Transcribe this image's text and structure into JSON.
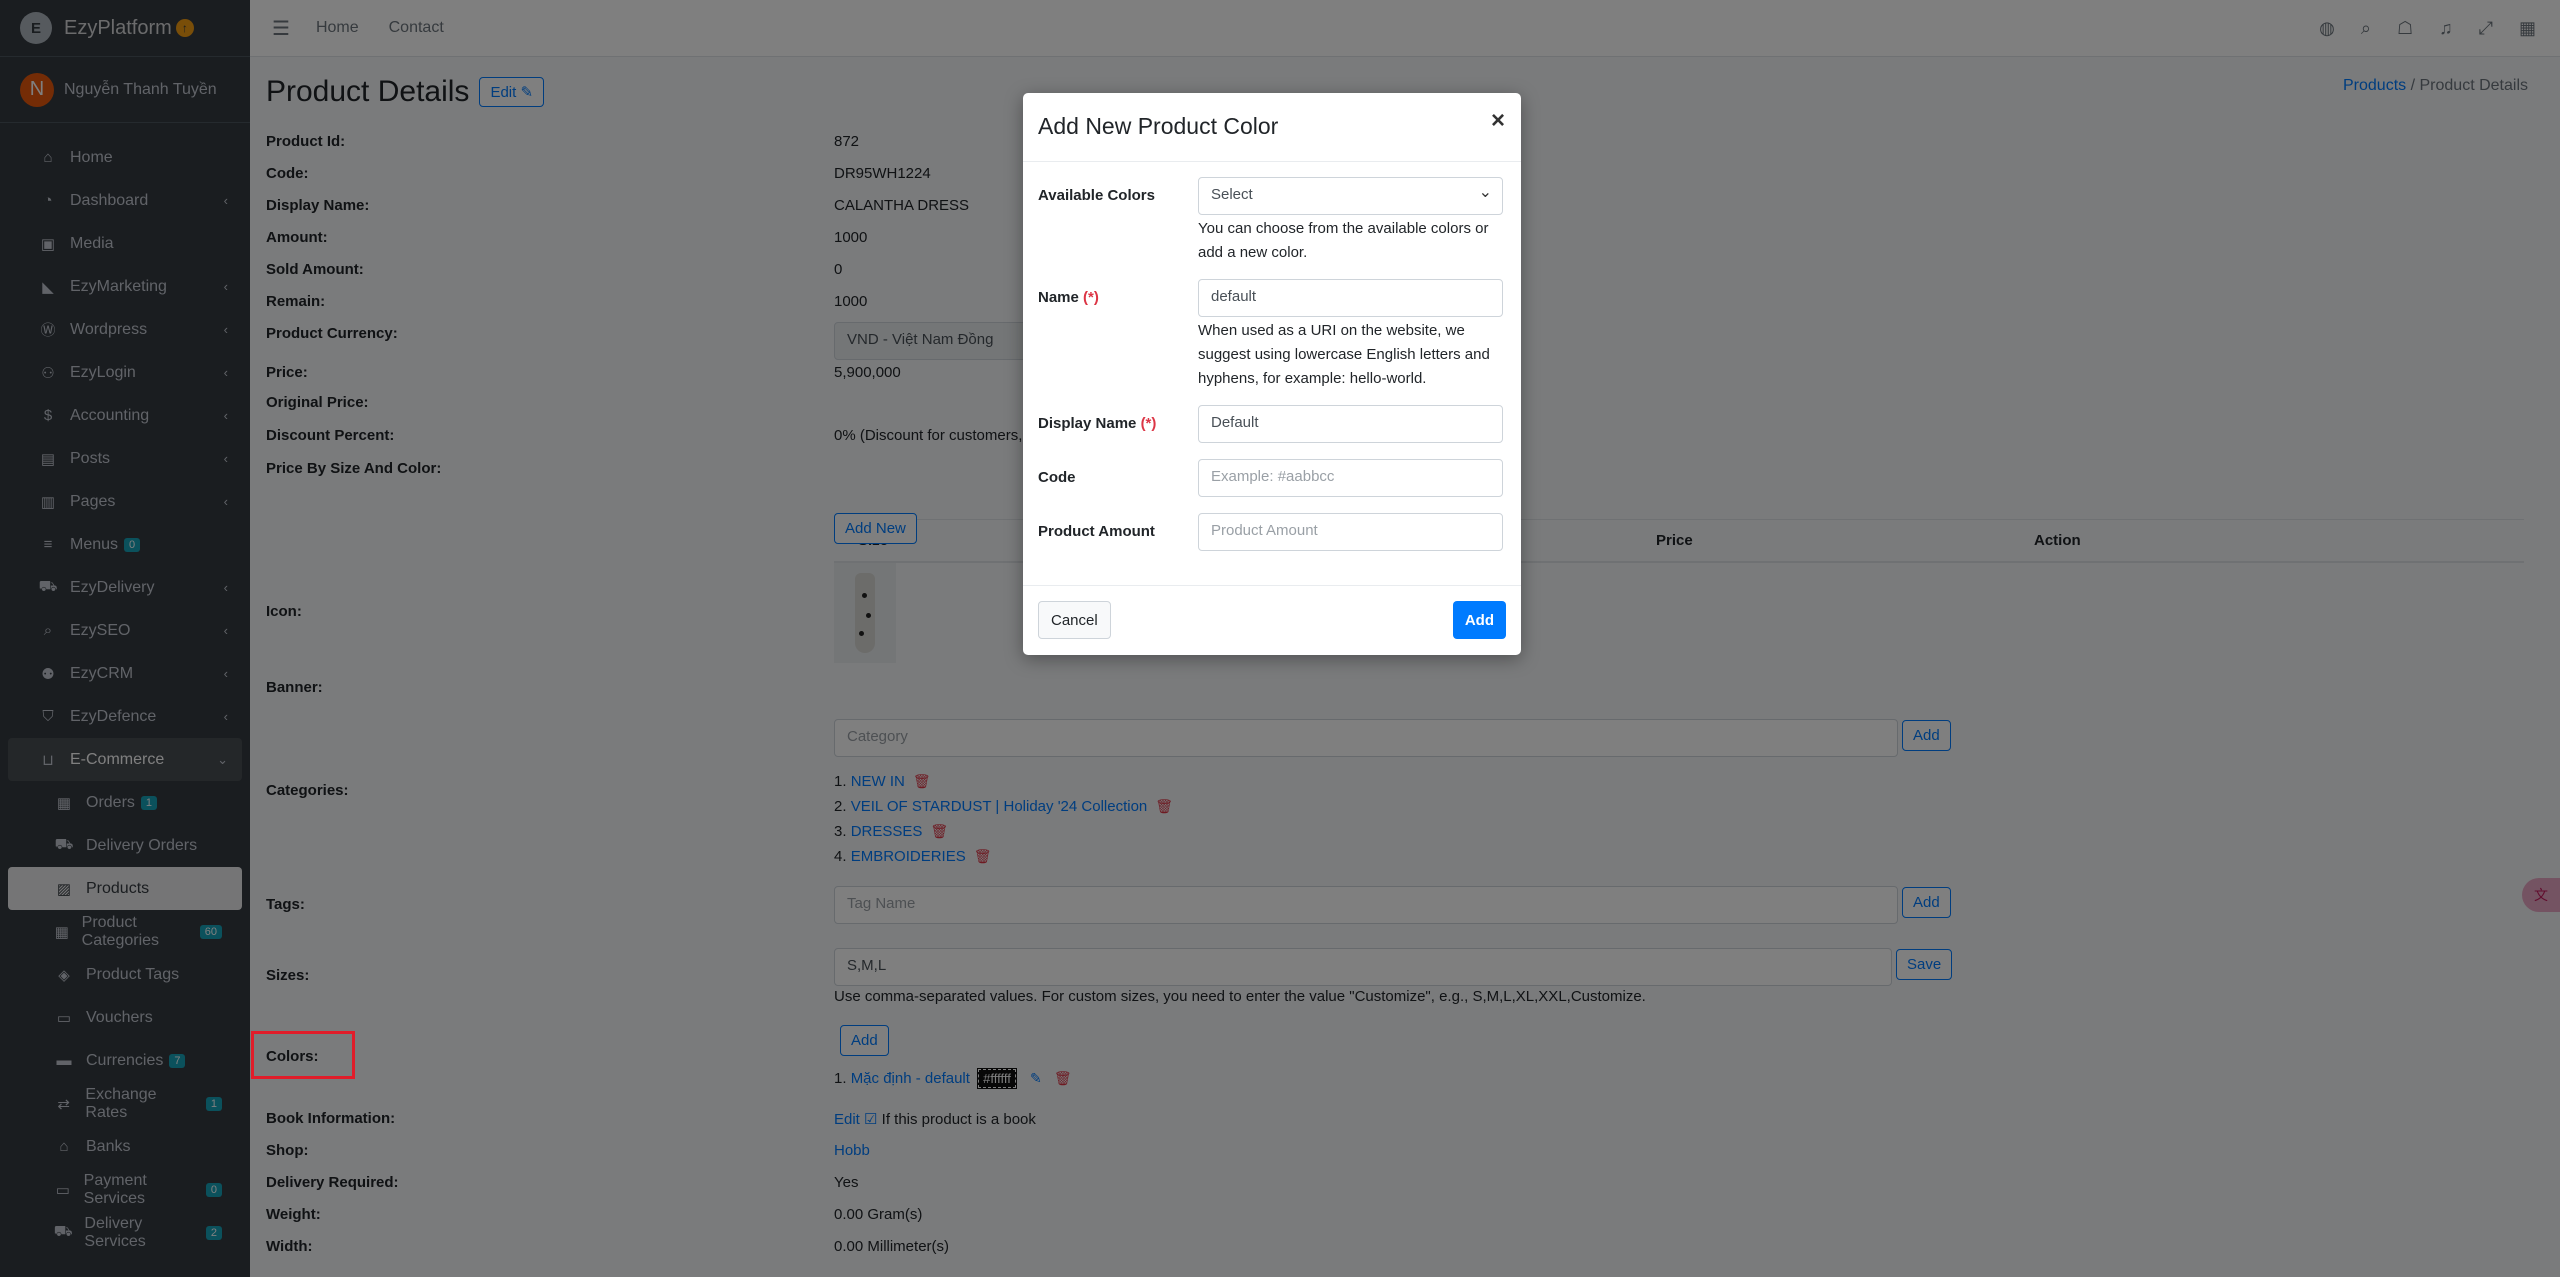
{
  "brand": {
    "name": "EzyPlatform",
    "logo_letter": "E"
  },
  "user": {
    "initial": "N",
    "name": "Nguyễn Thanh Tuyền"
  },
  "topbar": {
    "home": "Home",
    "contact": "Contact"
  },
  "sidebar": {
    "items": [
      {
        "label": "Home",
        "icon": "home-icon"
      },
      {
        "label": "Dashboard",
        "icon": "dashboard-icon"
      },
      {
        "label": "Media",
        "icon": "image-icon"
      },
      {
        "label": "EzyMarketing",
        "icon": "megaphone-icon"
      },
      {
        "label": "Wordpress",
        "icon": "wordpress-icon"
      },
      {
        "label": "EzyLogin",
        "icon": "user-lock-icon"
      },
      {
        "label": "Accounting",
        "icon": "money-icon"
      },
      {
        "label": "Posts",
        "icon": "file-icon"
      },
      {
        "label": "Pages",
        "icon": "columns-icon"
      },
      {
        "label": "Menus",
        "icon": "bars-icon",
        "badge": "0"
      },
      {
        "label": "EzyDelivery",
        "icon": "truck-icon"
      },
      {
        "label": "EzySEO",
        "icon": "search-icon"
      },
      {
        "label": "EzyCRM",
        "icon": "users-icon"
      },
      {
        "label": "EzyDefence",
        "icon": "shield-icon"
      },
      {
        "label": "E-Commerce",
        "icon": "basket-icon"
      },
      {
        "label": "Orders",
        "icon": "clipboard-icon",
        "badge": "1"
      },
      {
        "label": "Delivery Orders",
        "icon": "delivery-icon"
      },
      {
        "label": "Products",
        "icon": "boxes-icon"
      },
      {
        "label": "Product Categories",
        "icon": "clipboard-icon",
        "badge": "60"
      },
      {
        "label": "Product Tags",
        "icon": "tags-icon"
      },
      {
        "label": "Vouchers",
        "icon": "ticket-icon"
      },
      {
        "label": "Currencies",
        "icon": "money-bill-icon",
        "badge": "7"
      },
      {
        "label": "Exchange Rates",
        "icon": "exchange-icon",
        "badge": "1"
      },
      {
        "label": "Banks",
        "icon": "bank-icon"
      },
      {
        "label": "Payment Services",
        "icon": "credit-card-icon",
        "badge": "0"
      },
      {
        "label": "Delivery Services",
        "icon": "truck-icon",
        "badge": "2"
      }
    ]
  },
  "page": {
    "title": "Product Details",
    "edit_label": "Edit",
    "breadcrumb": {
      "parent": "Products",
      "separator": "/",
      "current": "Product Details"
    }
  },
  "details": {
    "product_id_label": "Product Id:",
    "product_id": "872",
    "code_label": "Code:",
    "code": "DR95WH1224",
    "display_name_label": "Display Name:",
    "display_name": "CALANTHA DRESS",
    "amount_label": "Amount:",
    "amount": "1000",
    "sold_label": "Sold Amount:",
    "sold": "0",
    "remain_label": "Remain:",
    "remain": "1000",
    "currency_label": "Product Currency:",
    "currency": "VND - Việt Nam Đồng",
    "price_label": "Price:",
    "price": "5,900,000",
    "original_price_label": "Original Price:",
    "discount_label": "Discount Percent:",
    "discount": "0% (Discount for customers,",
    "price_by_label": "Price By Size And Color:",
    "table_headers": {
      "size": "Size",
      "price": "Price",
      "action": "Action"
    },
    "add_new_label": "Add New",
    "icon_label": "Icon:",
    "banner_label": "Banner:",
    "categories_label": "Categories:",
    "category_placeholder": "Category",
    "add_label": "Add",
    "categories": [
      {
        "index": "1.",
        "name": "NEW IN"
      },
      {
        "index": "2.",
        "name": "VEIL OF STARDUST | Holiday '24 Collection"
      },
      {
        "index": "3.",
        "name": "DRESSES"
      },
      {
        "index": "4.",
        "name": "EMBROIDERIES"
      }
    ],
    "tags_label": "Tags:",
    "tag_placeholder": "Tag Name",
    "sizes_label": "Sizes:",
    "sizes": "S,M,L",
    "save_label": "Save",
    "sizes_help": "Use comma-separated values. For custom sizes, you need to enter the value \"Customize\", e.g., S,M,L,XL,XXL,Customize.",
    "colors_label": "Colors:",
    "color_item": {
      "index": "1.",
      "name": "Mặc định - default",
      "hex": "#ffffff"
    },
    "book_label": "Book Information:",
    "book_edit": "Edit",
    "book_help": "If this product is a book",
    "shop_label": "Shop:",
    "shop": "Hobb",
    "delivery_label": "Delivery Required:",
    "delivery": "Yes",
    "weight_label": "Weight:",
    "weight": "0.00 Gram(s)",
    "width_label": "Width:",
    "width": "0.00 Millimeter(s)"
  },
  "modal": {
    "title": "Add New Product Color",
    "close": "×",
    "available_colors_label": "Available Colors",
    "available_colors_value": "Select",
    "available_colors_help": "You can choose from the available colors or add a new color.",
    "name_label": "Name",
    "required_mark": "(*)",
    "name_value": "default",
    "name_help": "When used as a URI on the website, we suggest using lowercase English letters and hyphens, for example: hello-world.",
    "display_name_label": "Display Name",
    "display_name_value": "Default",
    "code_label": "Code",
    "code_placeholder": "Example: #aabbcc",
    "amount_label": "Product Amount",
    "amount_placeholder": "Product Amount",
    "cancel_label": "Cancel",
    "add_label": "Add"
  },
  "colors": {
    "primary": "#007bff",
    "danger": "#dc3545",
    "sidebar_bg": "#343a40"
  }
}
